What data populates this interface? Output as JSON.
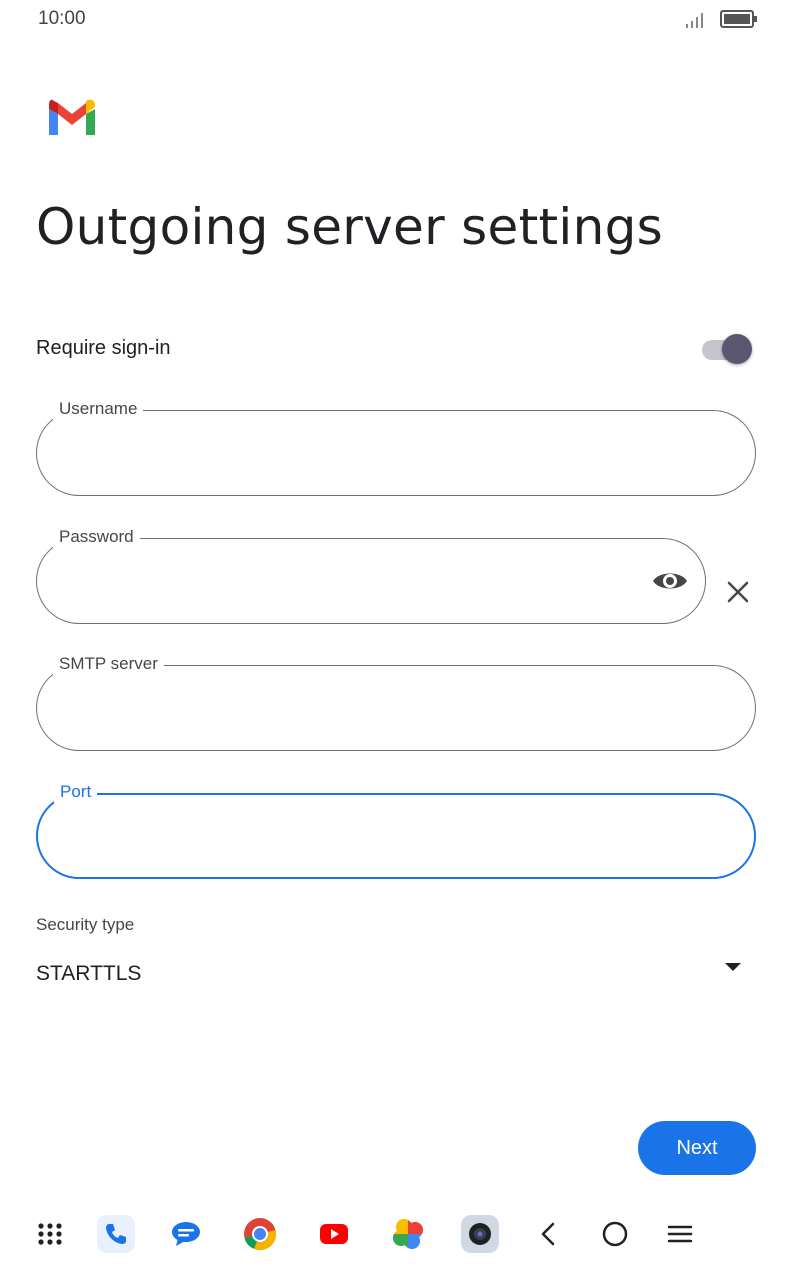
{
  "status_bar": {
    "time": "10:00",
    "signal_icon": "signal-icon",
    "battery_icon": "battery-icon"
  },
  "app": {
    "logo_icon": "gmail-logo"
  },
  "page": {
    "title": "Outgoing server settings"
  },
  "require_signin": {
    "label": "Require sign-in",
    "enabled": true
  },
  "fields": {
    "username": {
      "label": "Username",
      "value": ""
    },
    "password": {
      "label": "Password",
      "value": "",
      "toggle_icon": "eye-icon",
      "clear_icon": "close-icon"
    },
    "smtp_server": {
      "label": "SMTP server",
      "value": ""
    },
    "port": {
      "label": "Port",
      "value": "",
      "focused": true
    }
  },
  "security": {
    "label": "Security type",
    "selected": "STARTTLS",
    "icon": "dropdown-arrow-icon"
  },
  "actions": {
    "next_label": "Next"
  },
  "nav_bar": {
    "items": [
      "app-drawer-icon",
      "phone-icon",
      "messages-icon",
      "chrome-icon",
      "youtube-icon",
      "photos-icon",
      "camera-icon",
      "back-icon",
      "home-icon",
      "menu-icon"
    ]
  },
  "colors": {
    "accent": "#1a73e8",
    "toggle_thumb": "#5c5670",
    "toggle_track": "#c7c5cc",
    "border": "#6f6f6f"
  }
}
